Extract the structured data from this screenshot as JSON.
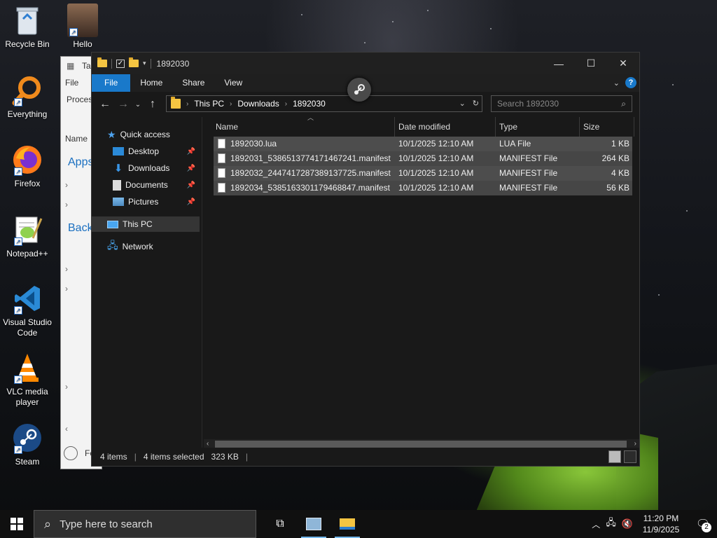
{
  "desktop": {
    "icons": [
      {
        "label": "Recycle Bin"
      },
      {
        "label": "Hello Neighbor"
      },
      {
        "label": "Everything"
      },
      {
        "label": "Firefox"
      },
      {
        "label": "Notepad++"
      },
      {
        "label": "Visual Studio Code"
      },
      {
        "label": "VLC media player"
      },
      {
        "label": "Steam"
      }
    ]
  },
  "task_manager": {
    "title": "Ta",
    "menu_file": "File",
    "tab_processes": "Proces",
    "col_name": "Name",
    "section_apps": "Apps",
    "section_background": "Back",
    "footer": "Fe"
  },
  "explorer": {
    "title": "1892030",
    "ribbon_tabs": [
      "File",
      "Home",
      "Share",
      "View"
    ],
    "breadcrumb": [
      "This PC",
      "Downloads",
      "1892030"
    ],
    "search_placeholder": "Search 1892030",
    "nav": {
      "quick_access": "Quick access",
      "desktop": "Desktop",
      "downloads": "Downloads",
      "documents": "Documents",
      "pictures": "Pictures",
      "this_pc": "This PC",
      "network": "Network"
    },
    "columns": {
      "name": "Name",
      "date": "Date modified",
      "type": "Type",
      "size": "Size"
    },
    "files": [
      {
        "name": "1892030.lua",
        "date": "10/1/2025 12:10 AM",
        "type": "LUA File",
        "size": "1 KB"
      },
      {
        "name": "1892031_5386513774171467241.manifest",
        "date": "10/1/2025 12:10 AM",
        "type": "MANIFEST File",
        "size": "264 KB"
      },
      {
        "name": "1892032_2447417287389137725.manifest",
        "date": "10/1/2025 12:10 AM",
        "type": "MANIFEST File",
        "size": "4 KB"
      },
      {
        "name": "1892034_5385163301179468847.manifest",
        "date": "10/1/2025 12:10 AM",
        "type": "MANIFEST File",
        "size": "56 KB"
      }
    ],
    "status": {
      "items": "4 items",
      "selected": "4 items selected",
      "size": "323 KB"
    }
  },
  "taskbar": {
    "search_placeholder": "Type here to search",
    "time": "11:20 PM",
    "date": "11/9/2025",
    "notifications": "2"
  },
  "colors": {
    "accent": "#1979ca",
    "folder": "#f5c542",
    "row_selected": "#4d4d4d"
  }
}
